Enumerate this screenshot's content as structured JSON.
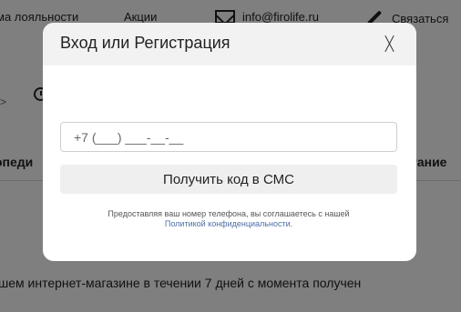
{
  "background": {
    "topnav": {
      "loyalty": "ма лояльности",
      "sales": "Акции",
      "email": "info@firolife.ru",
      "contact": "Связаться"
    },
    "left_arrow": ">",
    "category_left": "опеди",
    "category_right": "гание",
    "body_text": "шем интернет-магазине в течении 7 дней с момента получен"
  },
  "modal": {
    "title": "Вход или Регистрация",
    "close_label": "X",
    "phone_input": {
      "value": "+7 (___) ___-__-__",
      "placeholder": "+7 (___) ___-__-__"
    },
    "sms_button_label": "Получить код в СМС",
    "consent_text": "Предоставляя ваш номер телефона, вы соглашаетесь с нашей",
    "privacy_link": "Политикой конфиденциальности",
    "privacy_dot": "."
  }
}
